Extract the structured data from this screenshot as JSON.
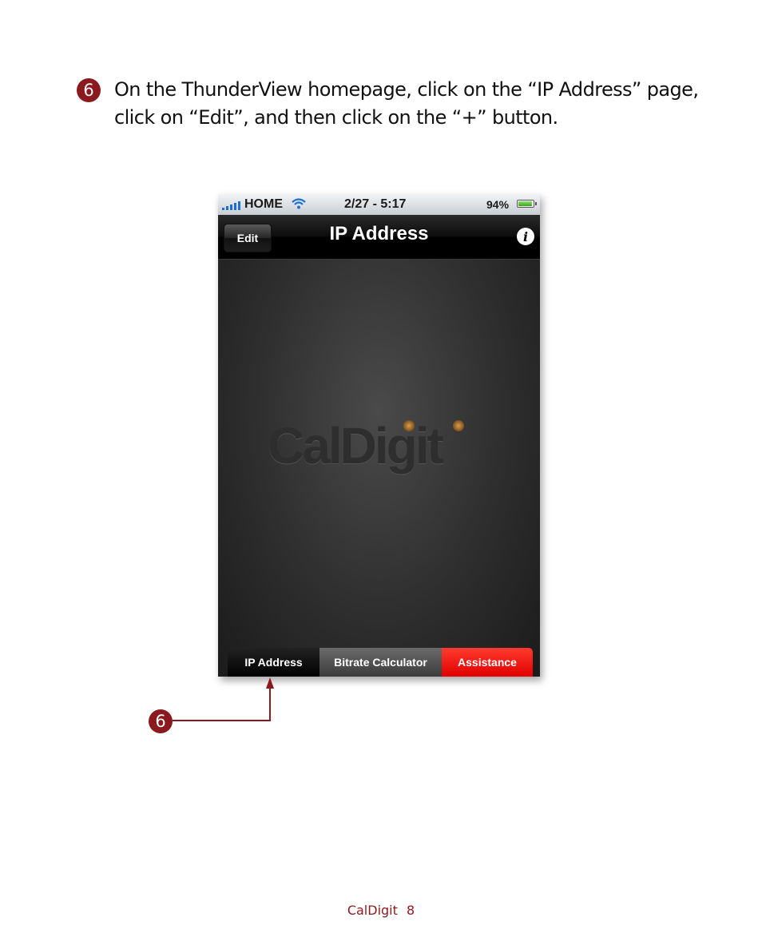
{
  "step": {
    "number": "6",
    "lines": [
      "On the ThunderView homepage, click on the “IP Address” page,",
      "click on “Edit”, and then click on the “+” button."
    ]
  },
  "phone": {
    "status_bar": {
      "carrier": "HOME",
      "time": "2/27 - 5:17",
      "battery_percent": "94%",
      "battery_level": 0.94,
      "icons": [
        "signal-icon",
        "wifi-icon",
        "battery-icon"
      ]
    },
    "nav_bar": {
      "edit_label": "Edit",
      "title": "IP Address",
      "info_icon": "info-icon",
      "info_glyph": "i"
    },
    "watermark": "CalDigit",
    "tabs": [
      {
        "label": "IP Address",
        "color": "#000000"
      },
      {
        "label": "Bitrate Calculator",
        "color": "#4a4a4a"
      },
      {
        "label": "Assistance",
        "color": "#ff1a1a"
      }
    ]
  },
  "callout": {
    "number": "6",
    "color": "#8b1a1f"
  },
  "footer": {
    "brand": "CalDigit",
    "page_number": "8"
  }
}
